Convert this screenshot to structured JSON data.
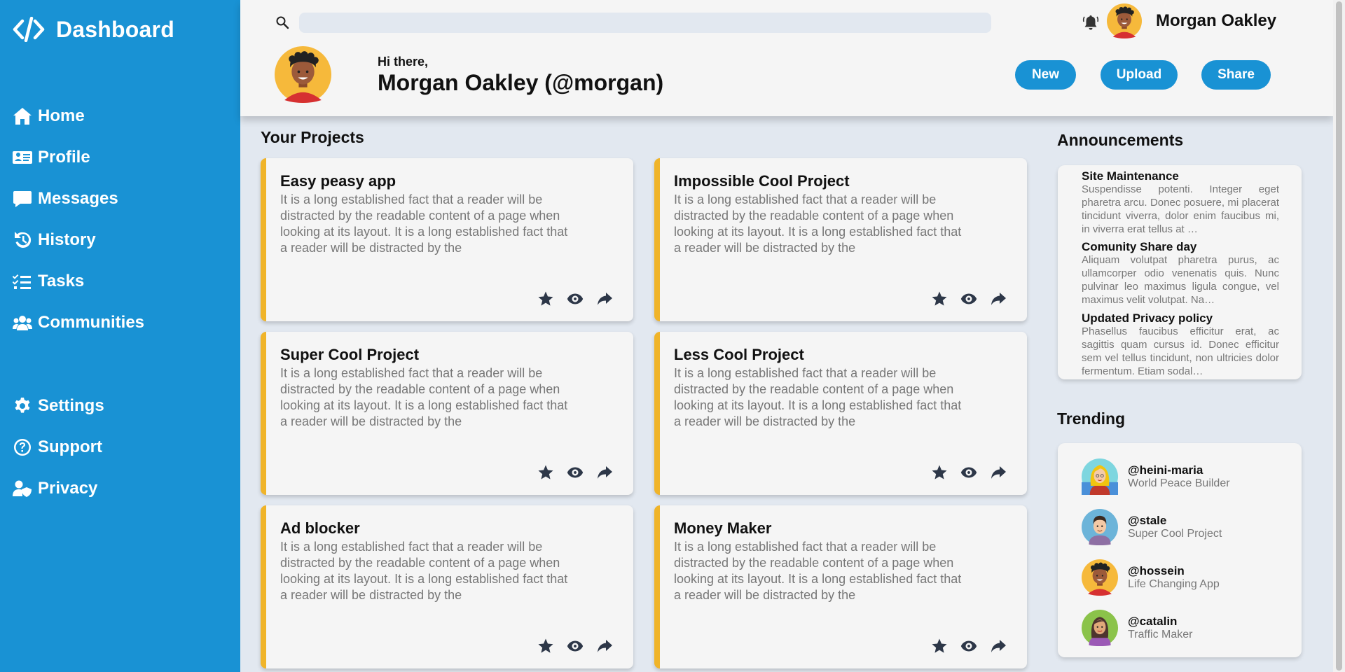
{
  "brand": {
    "title": "Dashboard",
    "icon": "code-icon"
  },
  "sidebar": {
    "main": [
      {
        "label": "Home",
        "icon": "home-icon"
      },
      {
        "label": "Profile",
        "icon": "id-card-icon"
      },
      {
        "label": "Messages",
        "icon": "message-icon"
      },
      {
        "label": "History",
        "icon": "history-icon"
      },
      {
        "label": "Tasks",
        "icon": "tasks-icon"
      },
      {
        "label": "Communities",
        "icon": "users-icon"
      }
    ],
    "bottom": [
      {
        "label": "Settings",
        "icon": "gear-icon"
      },
      {
        "label": "Support",
        "icon": "question-icon"
      },
      {
        "label": "Privacy",
        "icon": "user-shield-icon"
      }
    ]
  },
  "header": {
    "user_name": "Morgan Oakley",
    "greeting": "Hi there,",
    "full_name": "Morgan Oakley (@morgan)",
    "buttons": {
      "new": "New",
      "upload": "Upload",
      "share": "Share"
    }
  },
  "projects": {
    "title": "Your Projects",
    "items": [
      {
        "title": "Easy peasy app",
        "description": "It is a long established fact that a reader will be distracted by the readable content of a page when looking at its layout. It is a long established fact that a reader will be distracted by the"
      },
      {
        "title": "Impossible Cool Project",
        "description": "It is a long established fact that a reader will be distracted by the readable content of a page when looking at its layout. It is a long established fact that a reader will be distracted by the"
      },
      {
        "title": "Super Cool Project",
        "description": "It is a long established fact that a reader will be distracted by the readable content of a page when looking at its layout. It is a long established fact that a reader will be distracted by the"
      },
      {
        "title": "Less Cool Project",
        "description": "It is a long established fact that a reader will be distracted by the readable content of a page when looking at its layout. It is a long established fact that a reader will be distracted by the"
      },
      {
        "title": "Ad blocker",
        "description": "It is a long established fact that a reader will be distracted by the readable content of a page when looking at its layout. It is a long established fact that a reader will be distracted by the"
      },
      {
        "title": "Money Maker",
        "description": "It is a long established fact that a reader will be distracted by the readable content of a page when looking at its layout. It is a long established fact that a reader will be distracted by the"
      }
    ]
  },
  "announcements": {
    "title": "Announcements",
    "items": [
      {
        "title": "Site Maintenance",
        "text": "Suspendisse potenti. Integer eget pharetra arcu. Donec posuere, mi placerat tincidunt viverra, dolor enim faucibus mi, in viverra erat tellus at …"
      },
      {
        "title": "Comunity Share day",
        "text": "Aliquam volutpat pharetra purus, ac ullamcorper odio venenatis quis. Nunc pulvinar leo maximus ligula congue, vel maximus velit volutpat. Na…"
      },
      {
        "title": "Updated Privacy policy",
        "text": "Phasellus faucibus efficitur erat, ac sagittis quam cursus id. Donec efficitur sem vel tellus tincidunt, non ultricies dolor fermentum. Etiam sodal…"
      }
    ]
  },
  "trending": {
    "title": "Trending",
    "items": [
      {
        "handle": "@heini-maria",
        "project": "World Peace Builder"
      },
      {
        "handle": "@stale",
        "project": "Super Cool Project"
      },
      {
        "handle": "@hossein",
        "project": "Life Changing App"
      },
      {
        "handle": "@catalin",
        "project": "Traffic Maker"
      }
    ]
  },
  "colors": {
    "sidebar": "#1992d4",
    "accent": "#1992d4",
    "card_border": "#f0b429",
    "background": "#e2e8f0",
    "panel": "#f5f5f5"
  }
}
